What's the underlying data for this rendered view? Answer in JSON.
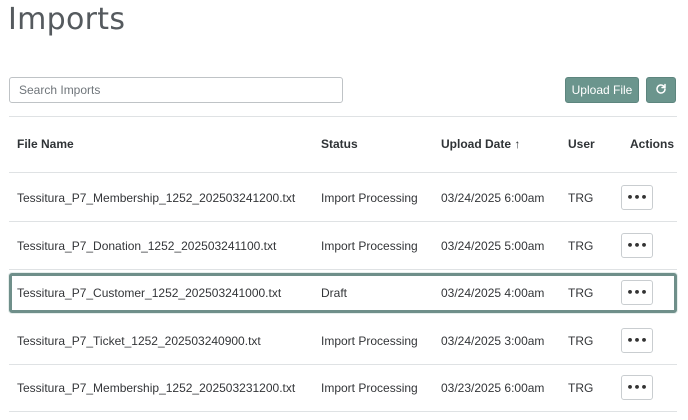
{
  "page": {
    "title": "Imports"
  },
  "search": {
    "placeholder": "Search Imports"
  },
  "toolbar": {
    "upload_label": "Upload File",
    "refresh_icon": "refresh-icon"
  },
  "table": {
    "columns": {
      "file_name": "File Name",
      "status": "Status",
      "upload_date": "Upload Date ↑",
      "user": "User",
      "actions": "Actions"
    },
    "rows": [
      {
        "file_name": "Tessitura_P7_Membership_1252_202503241200.txt",
        "status": "Import Processing",
        "upload_date": "03/24/2025 6:00am",
        "user": "TRG",
        "action_label": "•••"
      },
      {
        "file_name": "Tessitura_P7_Donation_1252_202503241100.txt",
        "status": "Import Processing",
        "upload_date": "03/24/2025 5:00am",
        "user": "TRG",
        "action_label": "•••"
      },
      {
        "file_name": "Tessitura_P7_Customer_1252_202503241000.txt",
        "status": "Draft",
        "upload_date": "03/24/2025 4:00am",
        "user": "TRG",
        "action_label": "•••"
      },
      {
        "file_name": "Tessitura_P7_Ticket_1252_202503240900.txt",
        "status": "Import Processing",
        "upload_date": "03/24/2025 3:00am",
        "user": "TRG",
        "action_label": "•••"
      },
      {
        "file_name": "Tessitura_P7_Membership_1252_202503231200.txt",
        "status": "Import Processing",
        "upload_date": "03/23/2025 6:00am",
        "user": "TRG",
        "action_label": "•••"
      }
    ]
  },
  "colors": {
    "accent": "#6b958d",
    "selected_border": "#6f8f8a"
  }
}
